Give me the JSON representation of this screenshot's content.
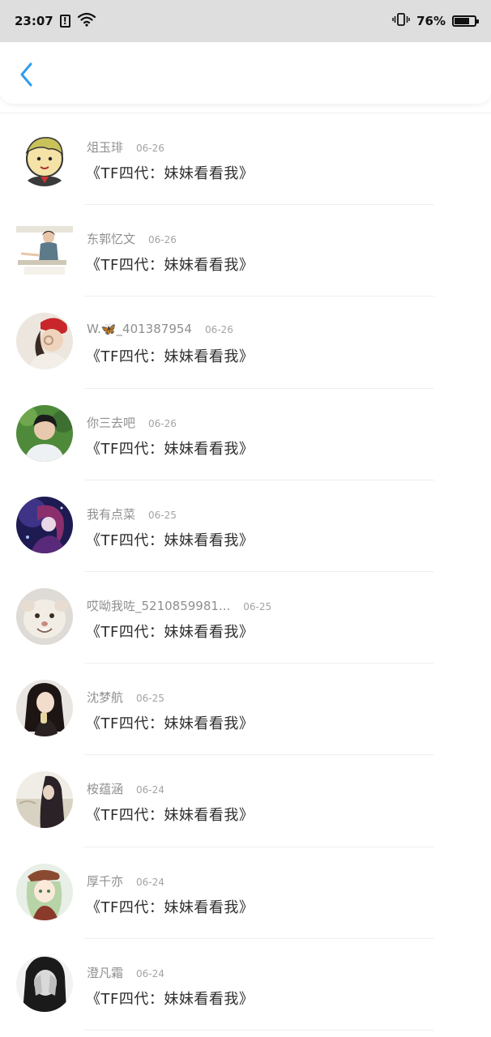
{
  "status_bar": {
    "time": "23:07",
    "alert_glyph": "!",
    "battery_percent": "76%",
    "battery_level": 0.76,
    "icons": [
      "alert-icon",
      "wifi-icon",
      "vibrate-icon",
      "battery-icon"
    ]
  },
  "nav": {
    "back_icon": "chevron-left-icon",
    "accent_color": "#2e9cf0"
  },
  "comments": [
    {
      "name": "俎玉琲",
      "date": "06-26",
      "text": "《TF四代：妹妹看看我》"
    },
    {
      "name": "东郭忆文",
      "date": "06-26",
      "text": "《TF四代：妹妹看看我》"
    },
    {
      "name": "W.🦋_401387954",
      "date": "06-26",
      "text": "《TF四代：妹妹看看我》"
    },
    {
      "name": "你三去吧",
      "date": "06-26",
      "text": "《TF四代：妹妹看看我》"
    },
    {
      "name": "我有点菜",
      "date": "06-25",
      "text": "《TF四代：妹妹看看我》"
    },
    {
      "name": "哎呦我咗_5210859981...",
      "date": "06-25",
      "text": "《TF四代：妹妹看看我》"
    },
    {
      "name": "沈梦航",
      "date": "06-25",
      "text": "《TF四代：妹妹看看我》"
    },
    {
      "name": "桉蕴涵",
      "date": "06-24",
      "text": "《TF四代：妹妹看看我》"
    },
    {
      "name": "厚千亦",
      "date": "06-24",
      "text": "《TF四代：妹妹看看我》"
    },
    {
      "name": "澄凡霜",
      "date": "06-24",
      "text": "《TF四代：妹妹看看我》"
    }
  ]
}
